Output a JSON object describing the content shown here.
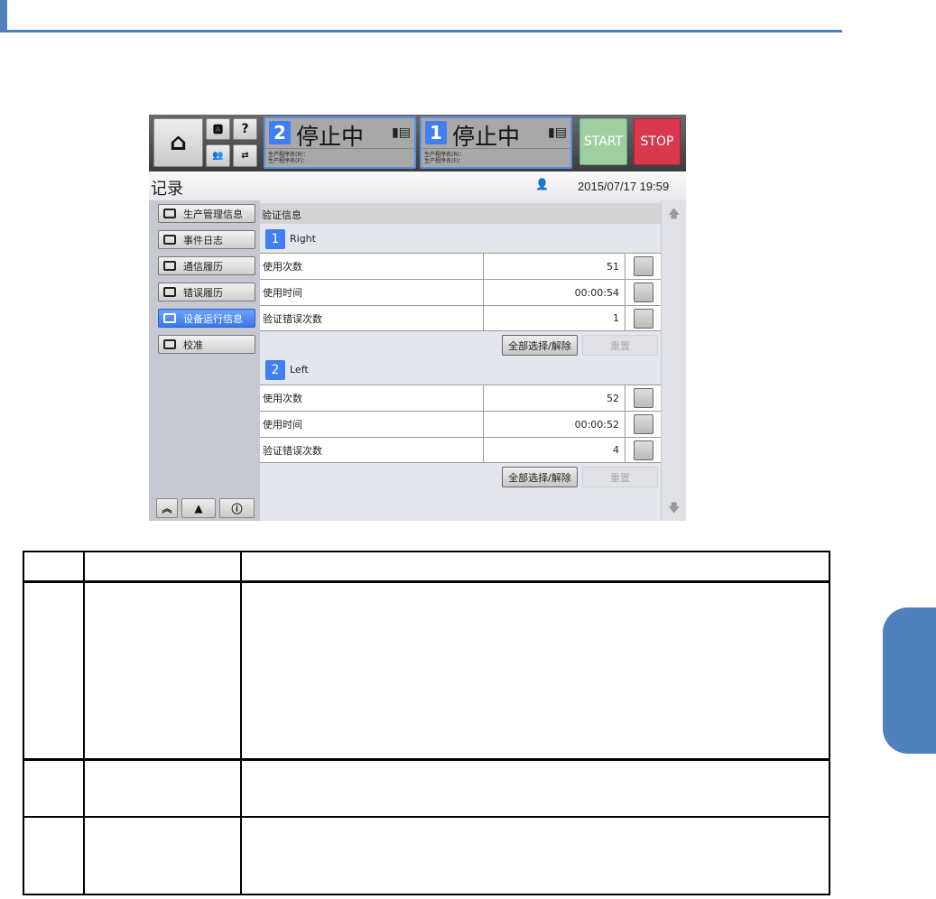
{
  "ui": {
    "panels": [
      {
        "num": "2",
        "status": "停止中",
        "line1": "生产程序名(R)：",
        "line2": "生产程序名(F)："
      },
      {
        "num": "1",
        "status": "停止中",
        "line1": "生产程序名(R)：",
        "line2": "生产程序名(F)："
      }
    ],
    "start_label": "START",
    "stop_label": "STOP",
    "title": "记录",
    "datetime": "2015/07/17 19:59",
    "sidebar": [
      "生产管理信息",
      "事件日志",
      "通信履历",
      "错误履历",
      "设备运行信息",
      "校准"
    ],
    "content_header": "验证信息",
    "sections": [
      {
        "num": "1",
        "name": "Right",
        "rows": [
          {
            "label": "使用次数",
            "value": "51"
          },
          {
            "label": "使用时间",
            "value": "00:00:54"
          },
          {
            "label": "验证错误次数",
            "value": "1"
          }
        ]
      },
      {
        "num": "2",
        "name": "Left",
        "rows": [
          {
            "label": "使用次数",
            "value": "52"
          },
          {
            "label": "使用时间",
            "value": "00:00:52"
          },
          {
            "label": "验证错误次数",
            "value": "4"
          }
        ]
      }
    ],
    "select_all_label": "全部选择/解除",
    "reset_label": "重置",
    "colors": {
      "accent": "#4f81bd",
      "start": "#9fcf9f",
      "stop": "#d9384e",
      "active": "#3f7ff0"
    }
  }
}
